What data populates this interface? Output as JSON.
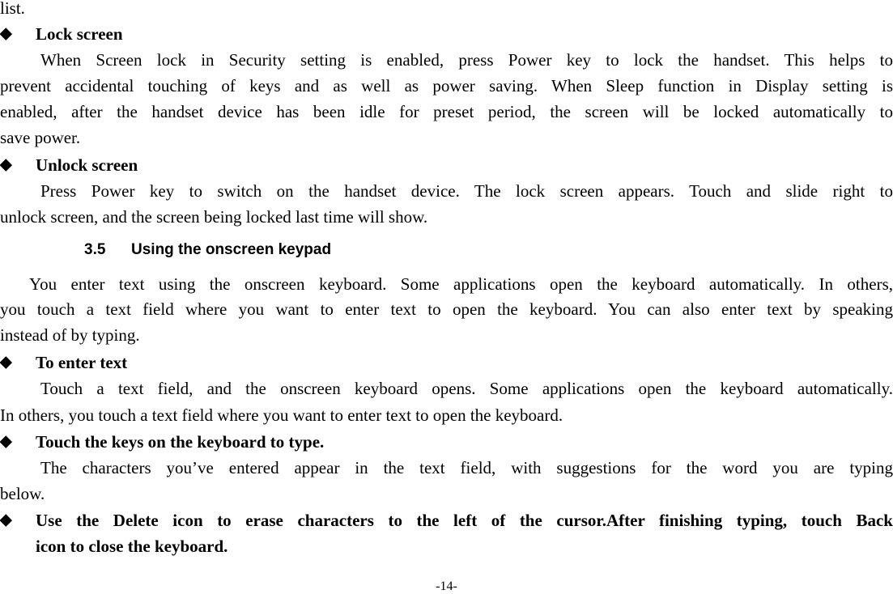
{
  "lines": {
    "l0": "list.",
    "lock_title": "Lock screen",
    "lock_p1": "When Screen lock in Security setting is enabled, press Power key to lock the handset. This helps to",
    "lock_p2": "prevent accidental touching of keys and as well as power saving. When Sleep function in Display setting is",
    "lock_p3": "enabled, after the handset device has been idle for preset period, the screen will be locked automatically to",
    "lock_p4": "save power.",
    "unlock_title": "Unlock screen",
    "unlock_p1": "Press Power key to switch on the handset device. The lock screen appears. Touch and slide right to",
    "unlock_p2": "unlock screen, and the screen being locked last time will show.",
    "sec_num": "3.5",
    "sec_title": "Using the onscreen keypad",
    "kp_p1": "You enter text using the onscreen keyboard. Some applications open the keyboard automatically. In others,",
    "kp_p2": "you touch a text field where you want to enter text to open the keyboard. You can also enter text by speaking",
    "kp_p3": "instead of by typing.",
    "enter_title": "To enter text",
    "enter_p1": "Touch a text field, and the onscreen keyboard opens. Some applications open the keyboard automatically.",
    "enter_p2": "In others, you touch a text field where you want to enter text to open the keyboard.",
    "touch_title": "Touch the keys on the keyboard to type.",
    "touch_p1": "The characters you’ve entered appear in the text field, with suggestions for the word you are typing",
    "touch_p2": "below.",
    "del_title1": "Use the Delete icon to erase characters to the left of the cursor.After finishing typing, touch Back",
    "del_title2": "icon to close the keyboard."
  },
  "bullet_glyph": "◆",
  "page_number": "-14-"
}
